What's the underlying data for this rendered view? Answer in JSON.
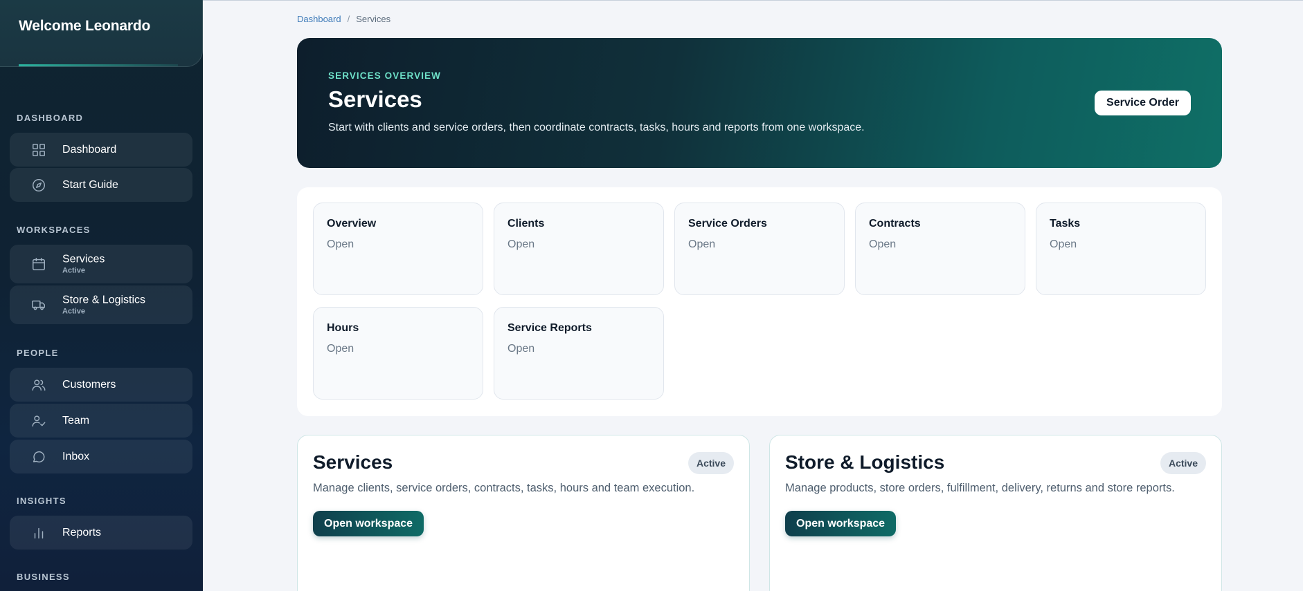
{
  "brand": {
    "title": "Welcome Leonardo"
  },
  "sidebar": {
    "sections": [
      {
        "label": "DASHBOARD"
      },
      {
        "label": "WORKSPACES"
      },
      {
        "label": "PEOPLE"
      },
      {
        "label": "INSIGHTS"
      },
      {
        "label": "BUSINESS"
      }
    ],
    "items": [
      {
        "label": "Dashboard",
        "icon": "grid-icon"
      },
      {
        "label": "Start Guide",
        "icon": "compass-icon"
      },
      {
        "label": "Services",
        "sub": "Active",
        "icon": "calendar-icon"
      },
      {
        "label": "Store & Logistics",
        "sub": "Active",
        "icon": "truck-icon"
      },
      {
        "label": "Customers",
        "icon": "users-icon"
      },
      {
        "label": "Team",
        "icon": "user-check-icon"
      },
      {
        "label": "Inbox",
        "icon": "message-icon"
      },
      {
        "label": "Reports",
        "icon": "bar-chart-icon"
      }
    ]
  },
  "breadcrumb": {
    "home": "Dashboard",
    "separator": "/",
    "current": "Services"
  },
  "hero": {
    "eyebrow": "SERVICES OVERVIEW",
    "title": "Services",
    "description": "Start with clients and service orders, then coordinate contracts, tasks, hours and reports from one workspace.",
    "button": "Service Order"
  },
  "tiles": [
    {
      "title": "Overview",
      "sub": "Open"
    },
    {
      "title": "Clients",
      "sub": "Open"
    },
    {
      "title": "Service Orders",
      "sub": "Open"
    },
    {
      "title": "Contracts",
      "sub": "Open"
    },
    {
      "title": "Tasks",
      "sub": "Open"
    },
    {
      "title": "Hours",
      "sub": "Open"
    },
    {
      "title": "Service Reports",
      "sub": "Open"
    }
  ],
  "workspaces": [
    {
      "title": "Services",
      "badge": "Active",
      "description": "Manage clients, service orders, contracts, tasks, hours and team execution.",
      "button": "Open workspace"
    },
    {
      "title": "Store & Logistics",
      "badge": "Active",
      "description": "Manage products, store orders, fulfillment, delivery, returns and store reports.",
      "button": "Open workspace"
    }
  ],
  "colors": {
    "accent": "#0f6b66",
    "eyebrow": "#6ee0c8",
    "sidebar": "#0f2433"
  }
}
